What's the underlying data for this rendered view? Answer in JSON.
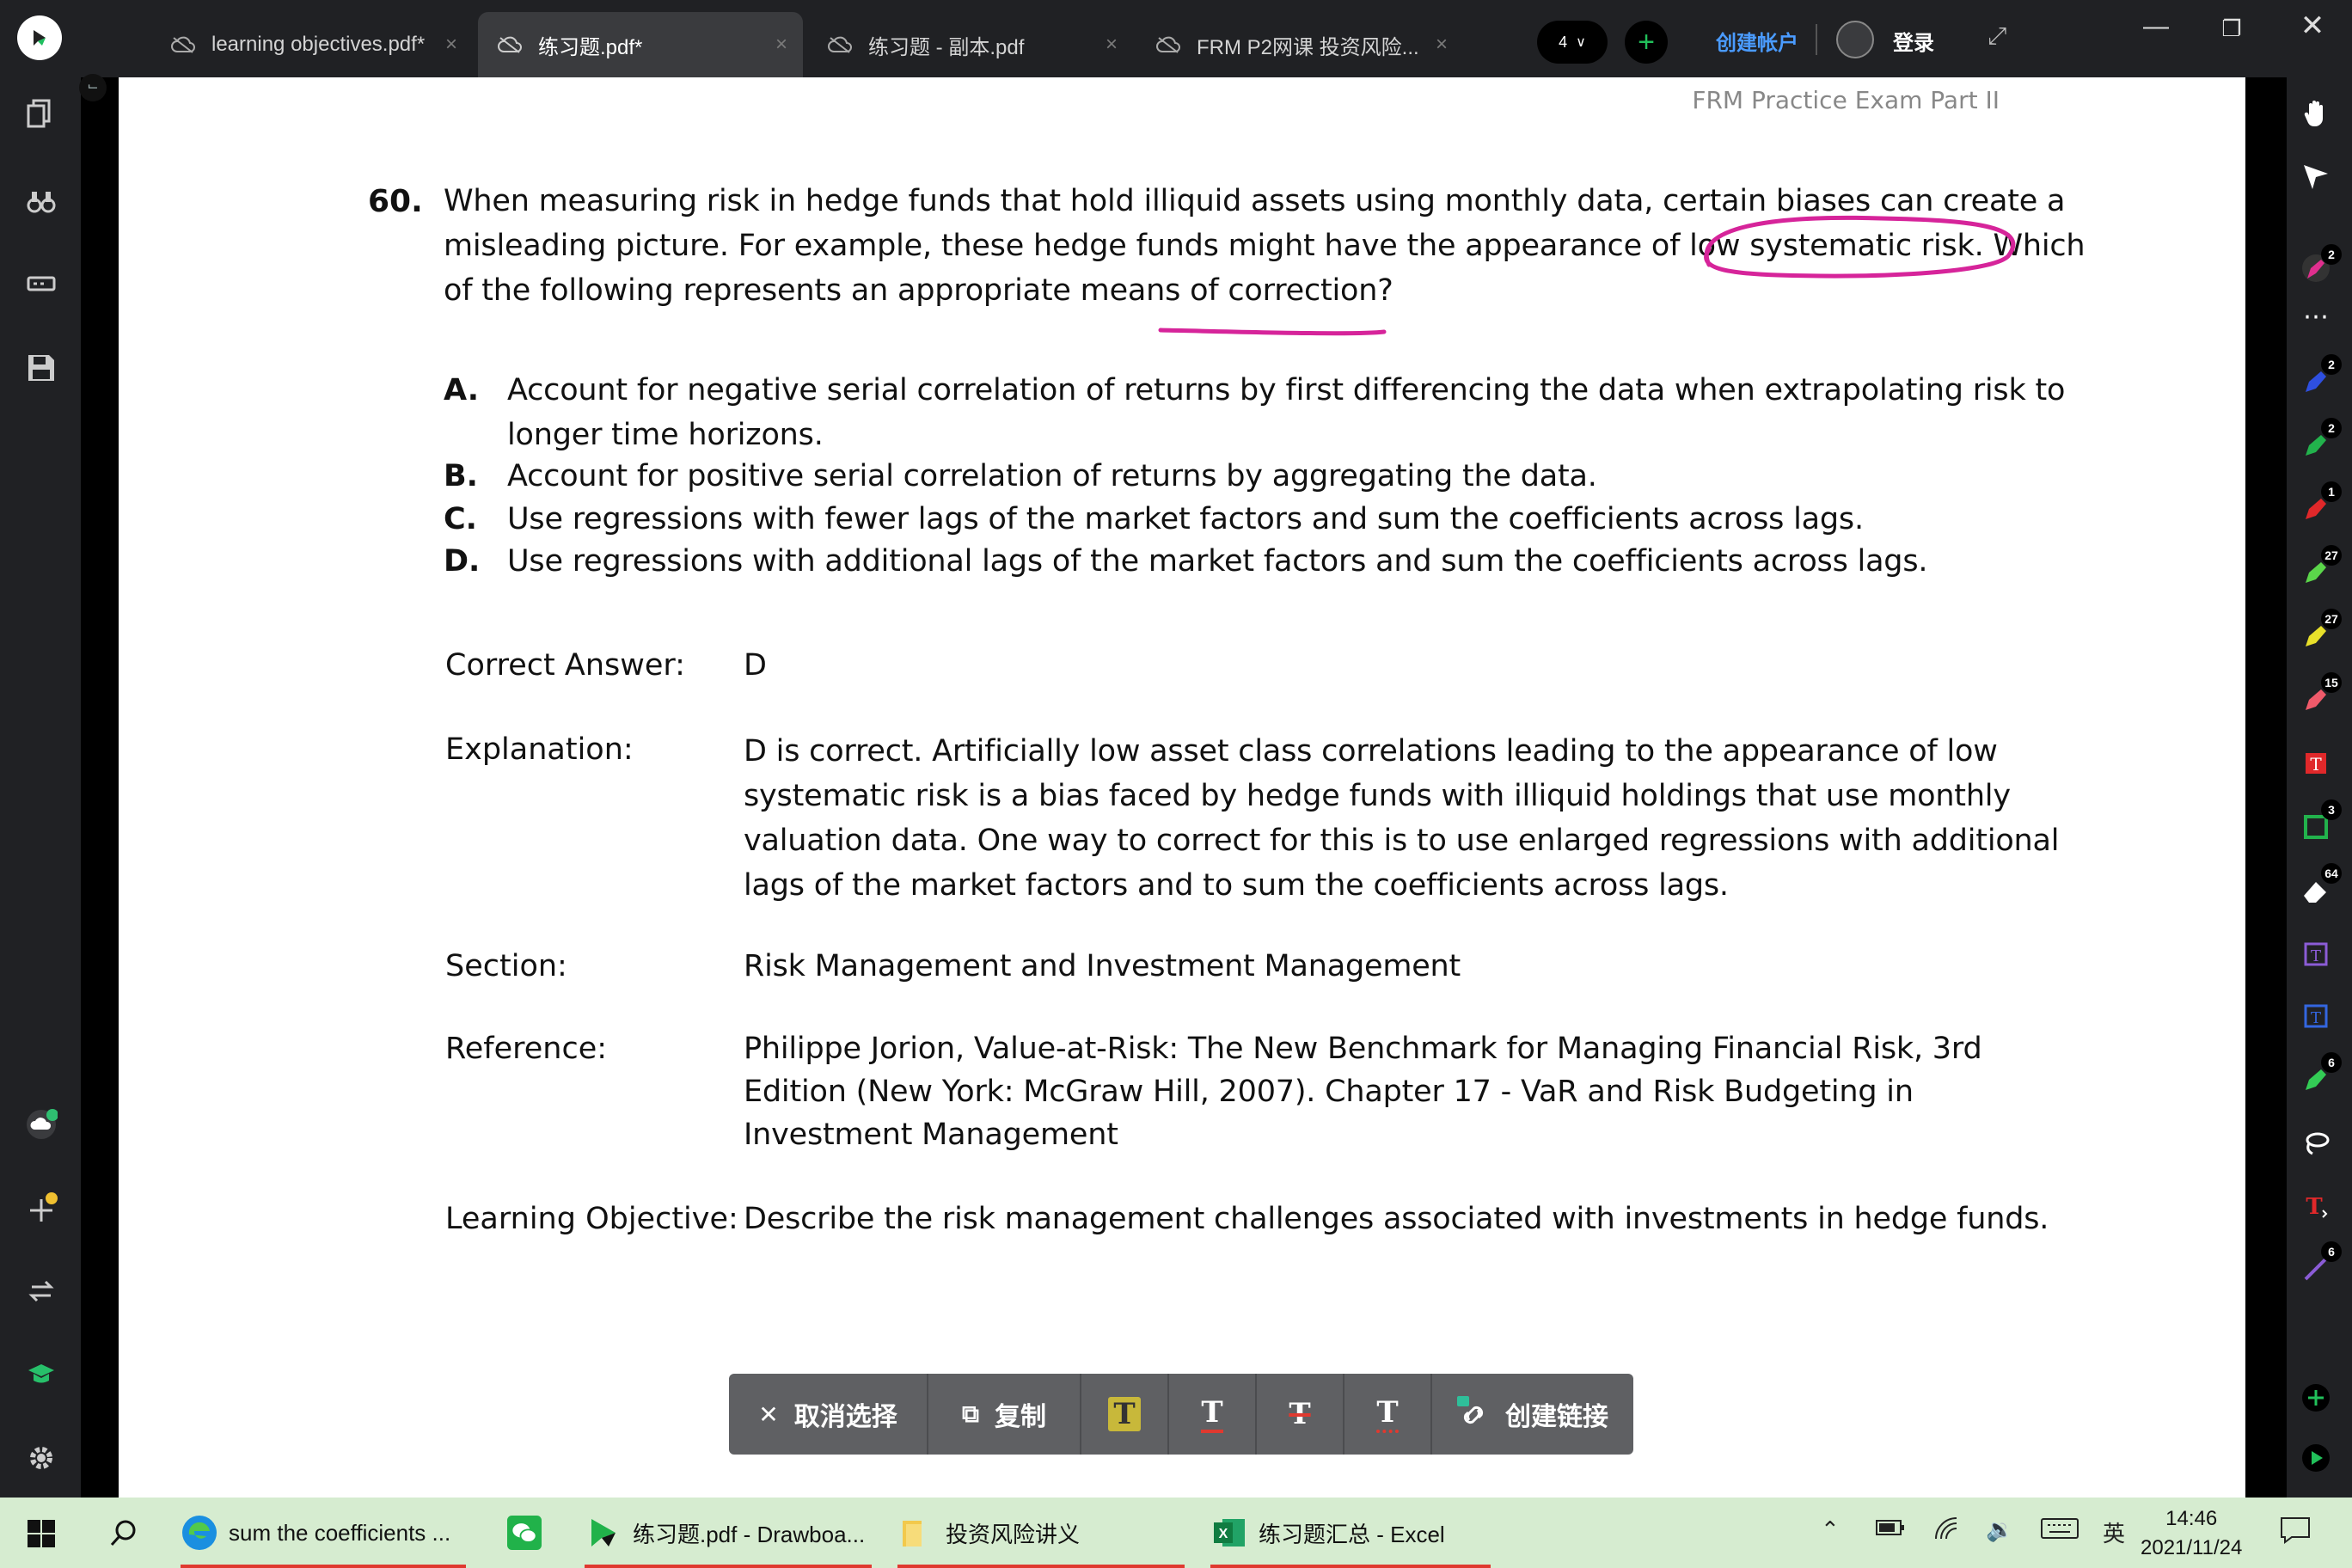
{
  "tabs": [
    {
      "label": "learning objectives.pdf*",
      "active": false
    },
    {
      "label": "练习题.pdf*",
      "active": true
    },
    {
      "label": "练习题 - 副本.pdf",
      "active": false
    },
    {
      "label": "FRM P2网课 投资风险...",
      "active": false
    }
  ],
  "titlebar": {
    "tab_count": "4",
    "create_account": "创建帐户",
    "login": "登录"
  },
  "document": {
    "header": "FRM Practice Exam Part II",
    "question_number": "60.",
    "question_lines": [
      "When measuring risk in hedge funds that hold illiquid assets using monthly data, certain biases can create a",
      "misleading picture. For example, these hedge funds might have the appearance of low systematic risk. Which",
      "of the following represents an appropriate means of correction?"
    ],
    "options": [
      {
        "letter": "A.",
        "lines": [
          "Account for negative serial correlation of returns by first differencing the data when extrapolating risk to",
          "longer time horizons."
        ]
      },
      {
        "letter": "B.",
        "lines": [
          "Account for positive serial correlation of returns by aggregating the data."
        ]
      },
      {
        "letter": "C.",
        "lines": [
          "Use regressions with fewer lags of the market factors and sum the coefficients across lags."
        ]
      },
      {
        "letter": "D.",
        "lines": [
          "Use regressions with additional lags of the market factors and sum the coefficients across lags."
        ]
      }
    ],
    "correct_answer_label": "Correct Answer:",
    "correct_answer": "D",
    "explanation_label": "Explanation:",
    "explanation_lines": [
      "D is correct. Artificially low asset class correlations leading to the appearance of low",
      "systematic risk is a bias faced by hedge funds with illiquid holdings that use monthly",
      "valuation data. One way to correct for this is to use enlarged regressions with additional",
      "lags of the market factors and to sum the coefficients across lags."
    ],
    "section_label": "Section:",
    "section": "Risk Management and Investment Management",
    "reference_label": "Reference:",
    "reference_lines": [
      "Philippe Jorion, Value-at-Risk: The New Benchmark for Managing Financial Risk, 3rd",
      "Edition (New York: McGraw Hill, 2007). Chapter 17 - VaR and Risk Budgeting in",
      "Investment Management"
    ],
    "lo_label": "Learning Objective:",
    "lo": "Describe the risk management challenges associated with investments in hedge funds.",
    "annotation_color": "#d6249a"
  },
  "selection_toolbar": {
    "deselect": "取消选择",
    "copy": "复制",
    "create_link": "创建链接"
  },
  "right_toolbar_badges": [
    "2",
    "2",
    "2",
    "1",
    "27",
    "27",
    "15",
    "3",
    "64",
    "6",
    "6"
  ],
  "taskbar": {
    "apps": [
      {
        "label": "sum the coefficients ...",
        "icon": "edge-icon"
      },
      {
        "label": "",
        "icon": "wechat-icon"
      },
      {
        "label": "练习题.pdf - Drawboa...",
        "icon": "drawboard-icon"
      },
      {
        "label": "投资风险讲义",
        "icon": "folder-icon"
      },
      {
        "label": "练习题汇总 - Excel",
        "icon": "excel-icon"
      }
    ],
    "ime": "英",
    "time": "14:46",
    "date": "2021/11/24"
  }
}
